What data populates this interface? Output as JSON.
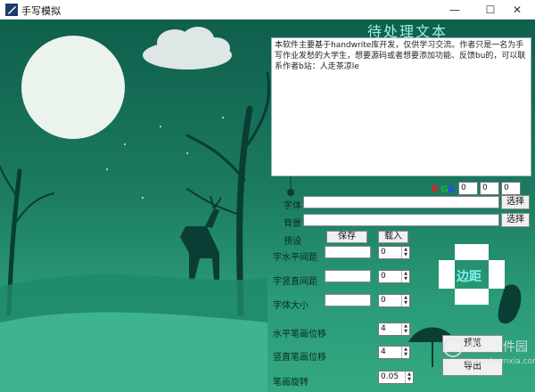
{
  "window": {
    "title": "手写模拟",
    "minimize_glyph": "—",
    "maximize_glyph": "☐",
    "close_glyph": "✕"
  },
  "panel": {
    "title": "待处理文本",
    "text": "本软件主要基于handwrite库开发，仅供学习交流。作者只是一名为手写作业发愁的大学生，想要源码或者想要添加功能、反馈bu的，可以联系作者b站：人走茶凉le"
  },
  "rgb": {
    "r_label": "R",
    "g_label": "G",
    "b_label": "B",
    "r_value": "0",
    "g_value": "0",
    "b_value": "0",
    "colors": {
      "r": "#e02020",
      "g": "#20b040",
      "b": "#2050e0"
    }
  },
  "font_row": {
    "label": "字体",
    "value": "",
    "button": "选择"
  },
  "background_row": {
    "label": "背景",
    "value": "",
    "button": "选择"
  },
  "preset_row": {
    "label": "预设",
    "save_button": "保存",
    "load_button": "载入"
  },
  "horizontal_spacing": {
    "label": "字水平间距",
    "value": "0"
  },
  "vertical_spacing": {
    "label": "字竖直间距",
    "value": "0"
  },
  "font_size": {
    "label": "字体大小",
    "value": "0"
  },
  "stroke_h_offset": {
    "label": "水平笔画位移",
    "value": "4"
  },
  "stroke_v_offset": {
    "label": "竖直笔画位移",
    "value": "4"
  },
  "stroke_rotation": {
    "label": "笔画旋转",
    "value": "0.05"
  },
  "margin": {
    "label": "边距"
  },
  "actions": {
    "preview": "预览",
    "export": "导出"
  },
  "watermark": {
    "text": "当下软件园",
    "sub": "www.downxia.com"
  },
  "icons": {
    "app": "app-logo-icon",
    "spinner_arrows": "spinner-arrows-icon"
  }
}
